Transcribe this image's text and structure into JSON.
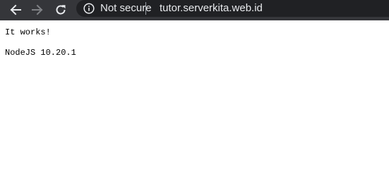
{
  "browser": {
    "security_label": "Not secure",
    "url": "tutor.serverkita.web.id",
    "colors": {
      "toolbar_bg": "#35363a",
      "omnibox_bg": "#202124",
      "text": "#e8eaed",
      "disabled_icon": "#7f8185"
    },
    "icons": {
      "back": "back-arrow-icon",
      "forward": "forward-arrow-icon",
      "reload": "reload-icon",
      "site_info": "info-icon"
    }
  },
  "page": {
    "lines": [
      "It works!",
      "NodeJS 10.20.1"
    ]
  }
}
